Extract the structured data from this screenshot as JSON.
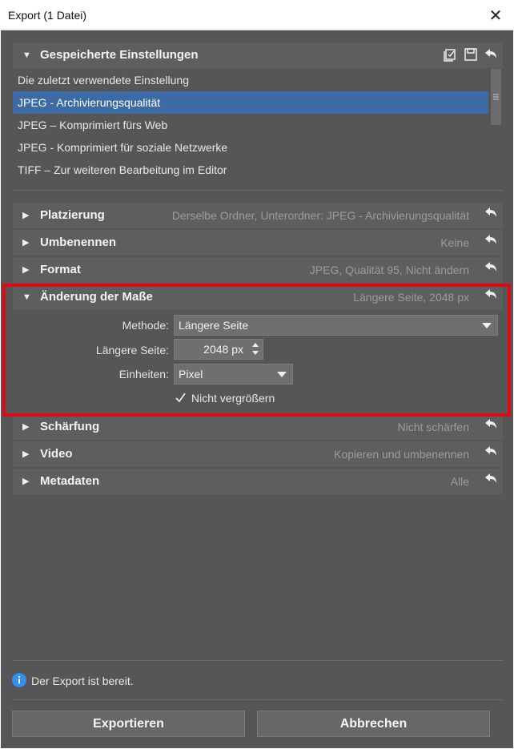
{
  "window": {
    "title": "Export (1 Datei)",
    "close_glyph": "✕"
  },
  "saved_settings": {
    "title": "Gespeicherte Einstellungen",
    "icons": [
      "save-as-preset-icon",
      "save-icon",
      "reset-icon"
    ],
    "items": [
      "Die zuletzt verwendete Einstellung",
      "JPEG - Archivierungsqualität",
      "JPEG – Komprimiert fürs Web",
      "JPEG - Komprimiert für soziale Netzwerke",
      "TIFF – Zur weiteren Bearbeitung im Editor"
    ],
    "selected_index": 1
  },
  "sections": {
    "placement": {
      "label": "Platzierung",
      "summary": "Derselbe Ordner, Unterordner: JPEG - Archivierungsqualität"
    },
    "rename": {
      "label": "Umbenennen",
      "summary": "Keine"
    },
    "format": {
      "label": "Format",
      "summary": "JPEG, Qualität 95, Nicht ändern"
    },
    "resize": {
      "label": "Änderung der Maße",
      "summary": "Längere Seite, 2048 px",
      "expanded": true,
      "method_label": "Methode:",
      "method_value": "Längere Seite",
      "long_side_label": "Längere Seite:",
      "long_side_value": "2048 px",
      "units_label": "Einheiten:",
      "units_value": "Pixel",
      "no_enlarge_label": "Nicht vergrößern",
      "no_enlarge_checked": true
    },
    "sharpen": {
      "label": "Schärfung",
      "summary": "Nicht schärfen"
    },
    "video": {
      "label": "Video",
      "summary": "Kopieren und umbenennen"
    },
    "metadata": {
      "label": "Metadaten",
      "summary": "Alle"
    }
  },
  "status": {
    "text": "Der Export ist bereit.",
    "icon": "info-icon"
  },
  "buttons": {
    "export": "Exportieren",
    "cancel": "Abbrechen"
  },
  "colors": {
    "panel_bg": "#565656",
    "header_bg": "#5e5e5e",
    "selection": "#3c6aa5",
    "highlight_border": "#e30613",
    "info_icon": "#2f8ff0"
  }
}
